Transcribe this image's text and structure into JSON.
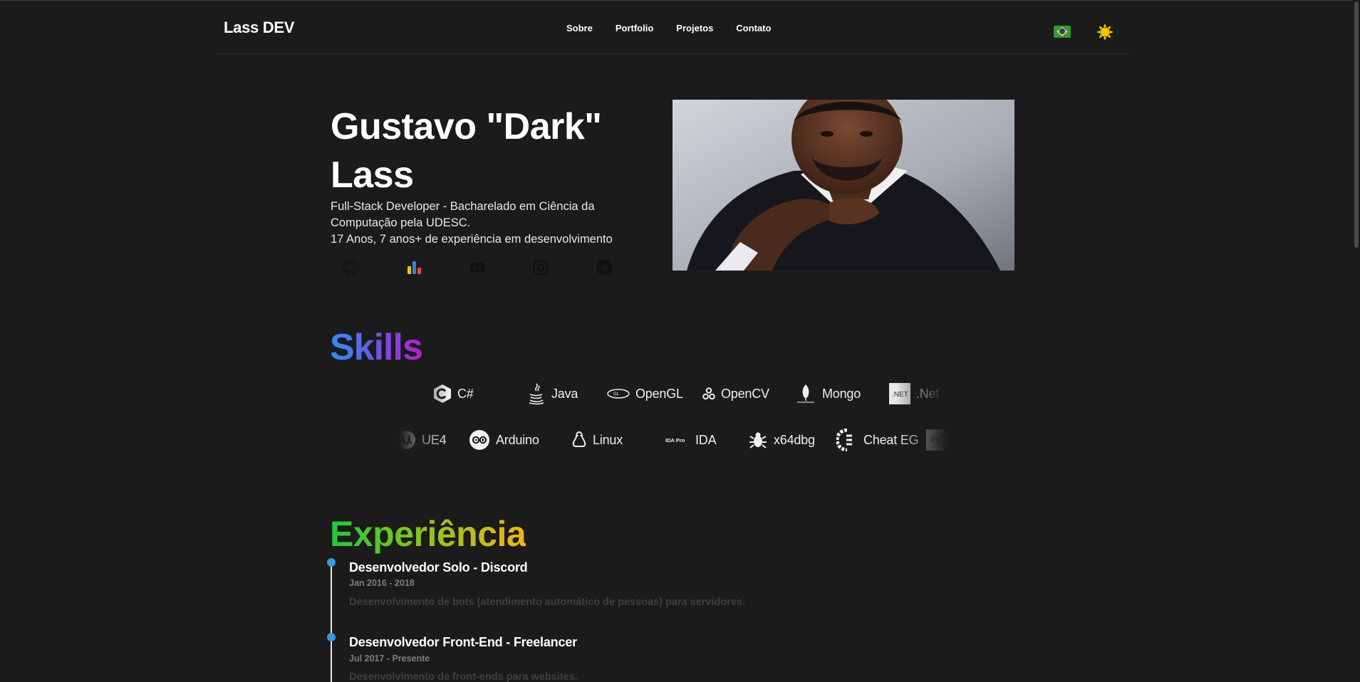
{
  "nav": {
    "brand": "Lass DEV",
    "links": [
      "Sobre",
      "Portfolio",
      "Projetos",
      "Contato"
    ],
    "language_icon": "brazil-flag-icon",
    "theme_icon": "sun-icon"
  },
  "hero": {
    "name": "Gustavo \"Dark\" Lass",
    "description_line1": "Full-Stack Developer - Bacharelado em Ciência da Computação pela UDESC.",
    "description_line2": "17 Anos, 7 anos+ de experiência em desenvolvimento",
    "socials": [
      "github-icon",
      "stats-icon",
      "discord-icon",
      "instagram-icon",
      "telegram-icon"
    ]
  },
  "skills": {
    "title": "Skills",
    "row1": [
      "C#",
      "Java",
      "OpenGL",
      "OpenCV",
      "Mongo",
      ".Net"
    ],
    "row2": [
      "UE4",
      "Arduino",
      "Linux",
      "IDA",
      "x64dbg",
      "Cheat EG"
    ],
    "row2_badges": {
      "ida": "IDA Pro",
      "ps": "Ps"
    }
  },
  "experience": {
    "title": "Experiência",
    "items": [
      {
        "title": "Desenvolvedor Solo - Discord",
        "date": "Jan 2016 - 2018",
        "description": "Desenvolvimento de bots (atendimento automático de pessoas) para servidores."
      },
      {
        "title": "Desenvolvedor Front-End - Freelancer",
        "date": "Jul 2017 - Presente",
        "description": "Desenvolvimento de front-ends para websites."
      }
    ]
  },
  "colors": {
    "background": "#1b1b1b",
    "timeline_dot": "#3c98d6",
    "skills_gradient": [
      "#2f8ef2",
      "#b61ec9"
    ],
    "experience_gradient": [
      "#22c83a",
      "#f2b418"
    ]
  }
}
